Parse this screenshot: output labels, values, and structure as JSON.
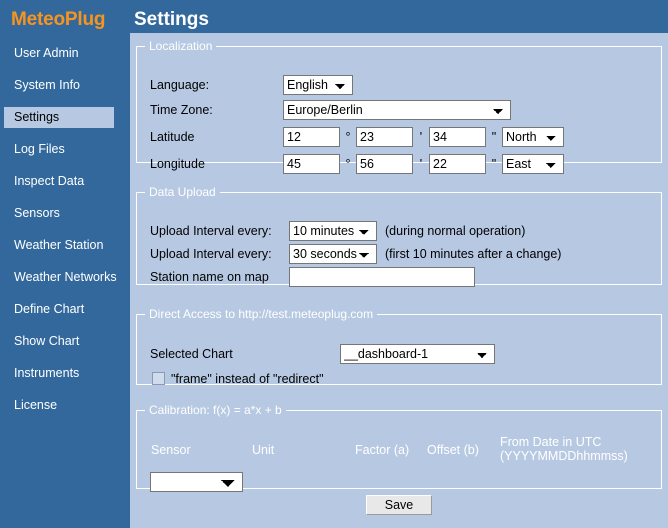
{
  "brand": "MeteoPlug",
  "page_title": "Settings",
  "colors": {
    "sidebar_bg": "#33689c",
    "brand_text": "#f7941e",
    "content_bg": "#b7c9e2",
    "legend_text": "#ffffff",
    "active_nav_bg": "#b7c9e2"
  },
  "sidebar": {
    "items": [
      {
        "label": "User Admin",
        "active": false
      },
      {
        "label": "System Info",
        "active": false
      },
      {
        "label": "Settings",
        "active": true
      },
      {
        "label": "Log Files",
        "active": false
      },
      {
        "label": "Inspect Data",
        "active": false
      },
      {
        "label": "Sensors",
        "active": false
      },
      {
        "label": "Weather Station",
        "active": false
      },
      {
        "label": "Weather Networks",
        "active": false
      },
      {
        "label": "Define Chart",
        "active": false
      },
      {
        "label": "Show Chart",
        "active": false
      },
      {
        "label": "Instruments",
        "active": false
      },
      {
        "label": "License",
        "active": false
      }
    ]
  },
  "localization": {
    "legend": "Localization",
    "language_label": "Language:",
    "language_value": "English",
    "timezone_label": "Time Zone:",
    "timezone_value": "Europe/Berlin",
    "latitude_label": "Latitude",
    "latitude_deg": "12",
    "latitude_min": "23",
    "latitude_sec": "34",
    "latitude_hemisphere": "North",
    "longitude_label": "Longitude",
    "longitude_deg": "45",
    "longitude_min": "56",
    "longitude_sec": "22",
    "longitude_hemisphere": "East",
    "deg_symbol": "°",
    "min_symbol": "'",
    "sec_symbol": "\""
  },
  "data_upload": {
    "legend": "Data Upload",
    "interval_normal_label": "Upload Interval every:",
    "interval_normal_value": "10 minutes",
    "interval_normal_note": "(during normal operation)",
    "interval_change_label": "Upload Interval every:",
    "interval_change_value": "30 seconds",
    "interval_change_note": "(first 10 minutes after a change)",
    "station_name_label": "Station name on map",
    "station_name_value": ""
  },
  "direct_access": {
    "legend": "Direct Access to http://test.meteoplug.com",
    "selected_chart_label": "Selected Chart",
    "selected_chart_value": "__dashboard-1",
    "frame_checkbox_label": "\"frame\" instead of \"redirect\"",
    "frame_checkbox_checked": false
  },
  "calibration": {
    "legend": "Calibration: f(x) = a*x + b",
    "col_sensor": "Sensor",
    "col_unit": "Unit",
    "col_factor": "Factor (a)",
    "col_offset": "Offset (b)",
    "col_from_date_line1": "From Date in UTC",
    "col_from_date_line2": "(YYYYMMDDhhmmss)",
    "sensor_value": ""
  },
  "footer": {
    "save_label": "Save"
  }
}
